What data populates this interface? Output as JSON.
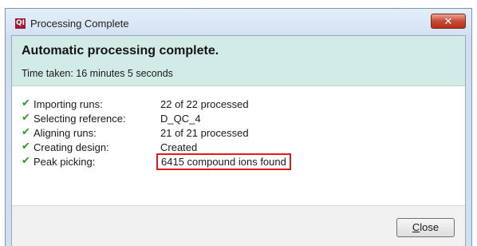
{
  "window": {
    "title": "Processing Complete",
    "app_icon_text": "QI",
    "close_glyph": "✕"
  },
  "header": {
    "heading": "Automatic processing complete.",
    "time_taken": "Time taken: 16 minutes 5 seconds"
  },
  "steps": [
    {
      "label": "Importing runs:",
      "value": "22 of 22 processed",
      "status": "check-icon"
    },
    {
      "label": "Selecting reference:",
      "value": "D_QC_4",
      "status": "check-icon"
    },
    {
      "label": "Aligning runs:",
      "value": "21 of 21 processed",
      "status": "check-icon"
    },
    {
      "label": "Creating design:",
      "value": "Created",
      "status": "check-icon"
    },
    {
      "label": "Peak picking:",
      "value": "6415 compound ions found",
      "status": "check-icon",
      "highlighted": true
    }
  ],
  "footer": {
    "close_accel": "C",
    "close_rest": "lose"
  },
  "colors": {
    "check": "#2e9b2e",
    "highlight_border": "#e21b1b",
    "header_band": "#d3ebe7"
  }
}
